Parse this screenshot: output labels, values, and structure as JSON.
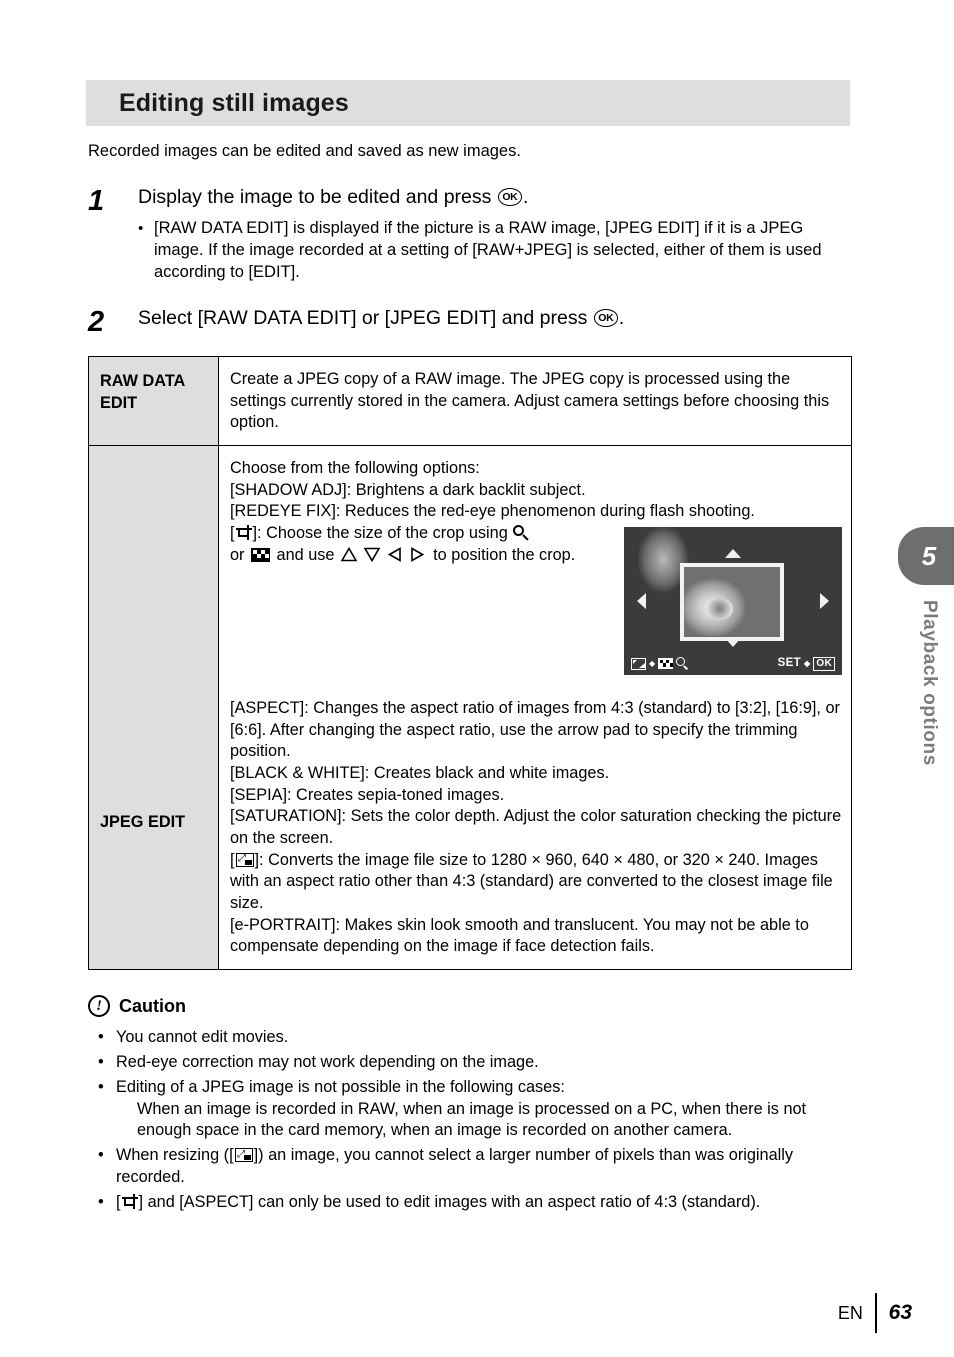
{
  "header": {
    "title": "Editing still images"
  },
  "intro": "Recorded images can be edited and saved as new images.",
  "steps": [
    {
      "num": "1",
      "title_before": "Display the image to be edited and press",
      "ok_label": "OK",
      "title_after": ".",
      "bullet": "•",
      "sub": "[RAW DATA EDIT] is displayed if the picture is a RAW image, [JPEG EDIT] if it is a JPEG image. If the image recorded at a setting of [RAW+JPEG] is selected, either of them is used according to [EDIT]."
    },
    {
      "num": "2",
      "title_before": "Select [RAW DATA EDIT] or [JPEG EDIT] and press",
      "ok_label": "OK",
      "title_after": "."
    }
  ],
  "table": {
    "rows": [
      {
        "label": "RAW DATA EDIT",
        "desc": "Create a JPEG copy of a RAW image. The JPEG copy is processed using the settings currently stored in the camera. Adjust camera settings before choosing this option."
      },
      {
        "label": "JPEG EDIT",
        "desc_top_lines": [
          "Choose from the following options:",
          "[SHADOW ADJ]: Brightens a dark backlit subject.",
          "[REDEYE FIX]: Reduces the red-eye phenomenon during flash shooting."
        ],
        "crop_line": {
          "part1": "]: Choose the size of the crop using",
          "part2": "or",
          "part3": "and use",
          "part4": "to position the crop."
        },
        "desc_bottom_lines": [
          "[ASPECT]: Changes the aspect ratio of images from 4:3 (standard) to [3:2], [16:9], or [6:6]. After changing the aspect ratio, use the arrow pad to specify the trimming position.",
          "[BLACK & WHITE]: Creates black and white images.",
          "[SEPIA]: Creates sepia-toned images.",
          "[SATURATION]: Sets the color depth. Adjust the color saturation checking the picture on the screen."
        ],
        "resize_line": {
          "prefix": "[",
          "suffix": "]: Converts the image file size to 1280 × 960, 640 × 480, or 320 × 240. Images with an aspect ratio other than 4:3 (standard) are converted to the closest image file size."
        },
        "desc_last_line": "[e-PORTRAIT]: Makes skin look smooth and translucent. You may not be able to compensate depending on the image if face detection fails."
      }
    ]
  },
  "lcd": {
    "set_label": "SET",
    "diamond": "◆",
    "ok_label": "OK",
    "icon_resize": "resize-icon",
    "icon_grid": "index-grid-icon",
    "icon_magnifier": "magnifier-icon"
  },
  "caution": {
    "icon": "caution-icon",
    "icon_glyph": "!",
    "heading": "Caution",
    "bullet": "•",
    "items": [
      {
        "text": "You cannot edit movies."
      },
      {
        "text": "Red-eye correction may not work depending on the image."
      },
      {
        "text": "Editing of a JPEG image is not possible in the following cases:",
        "sub": "When an image is recorded in RAW, when an image is processed on a PC, when there is not enough space in the card memory, when an image is recorded on another camera."
      },
      {
        "text_before": "When resizing ([",
        "text_after": "]) an image, you cannot select a larger number of pixels than was originally recorded."
      },
      {
        "text_before": "[",
        "text_after": "] and [ASPECT] can only be used to edit images with an aspect ratio of 4:3 (standard)."
      }
    ]
  },
  "sidebar": {
    "chapter_number": "5",
    "chapter_label": "Playback options"
  },
  "footer": {
    "language": "EN",
    "page_number": "63"
  },
  "colors": {
    "header_bg": "#dededf",
    "table_label_bg": "#dededf",
    "chapter_tab_bg": "#6e6e6e",
    "chapter_label_color": "#7c7c7c"
  }
}
